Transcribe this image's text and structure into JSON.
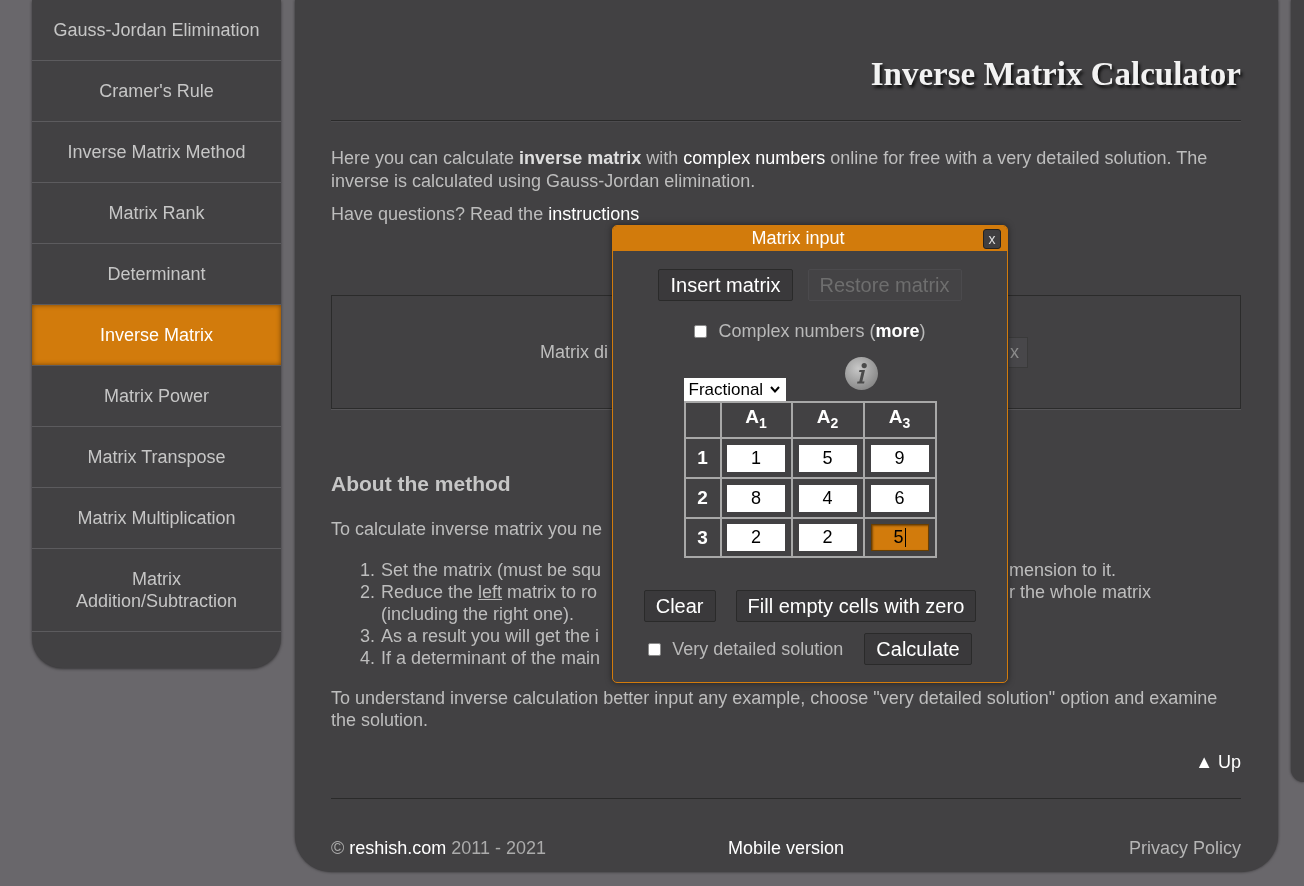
{
  "sidebar": {
    "items": [
      {
        "label": "Gauss-Jordan Elimination",
        "selected": false
      },
      {
        "label": "Cramer's Rule",
        "selected": false
      },
      {
        "label": "Inverse Matrix Method",
        "selected": false
      },
      {
        "label": "Matrix Rank",
        "selected": false
      },
      {
        "label": "Determinant",
        "selected": false
      },
      {
        "label": "Inverse Matrix",
        "selected": true
      },
      {
        "label": "Matrix Power",
        "selected": false
      },
      {
        "label": "Matrix Transpose",
        "selected": false
      },
      {
        "label": "Matrix Multiplication",
        "selected": false
      },
      {
        "label": "Matrix Addition/Subtraction",
        "selected": false
      }
    ]
  },
  "content": {
    "title": "Inverse Matrix Calculator",
    "intro": {
      "before": "Here you can calculate **inverse matrix** with ",
      "link": "complex numbers",
      "after": " online for free with a very detailed solution. The inverse is calculated using Gauss-Jordan elimination."
    },
    "help": {
      "text": "Have questions? Read the",
      "link": "instructions"
    },
    "dimension_box": {
      "label": "Matrix di",
      "button": "x"
    },
    "method": {
      "heading": "About the method",
      "lead": "To calculate inverse matrix you ne",
      "steps": [
        {
          "number": "1.",
          "lines": [
            {
              "left": [
                {
                  "text": "Set the matrix (must be squ",
                  "underlined": false
                }
              ],
              "right": "mension to it."
            }
          ]
        },
        {
          "number": "2.",
          "lines": [
            {
              "left": [
                {
                  "text": "Reduce the ",
                  "underlined": false
                },
                {
                  "text": "left",
                  "underlined": true
                },
                {
                  "text": " matrix to ro",
                  "underlined": false
                }
              ],
              "right": "r the whole matrix"
            },
            {
              "left": [
                {
                  "text": "(including the right one).",
                  "underlined": false
                }
              ]
            }
          ]
        },
        {
          "number": "3.",
          "lines": [
            {
              "left": [
                {
                  "text": "As a result you will get the i",
                  "underlined": false
                }
              ]
            }
          ]
        },
        {
          "number": "4.",
          "lines": [
            {
              "left": [
                {
                  "text": "If a determinant of the main",
                  "underlined": false
                }
              ]
            }
          ]
        }
      ],
      "closing": "To understand inverse calculation better input any example, choose \"very detailed solution\" option and examine the solution.",
      "up_link": "▲ Up"
    },
    "footer": {
      "copyright": "©",
      "site_link": "reshish.com",
      "years": "2011 - 2021",
      "mobile_link": "Mobile version",
      "privacy_link": "Privacy Policy"
    }
  },
  "dialog": {
    "title": "Matrix input",
    "close": "x",
    "top_buttons": [
      {
        "label": "Insert matrix",
        "disabled": false
      },
      {
        "label": "Restore matrix",
        "disabled": true
      }
    ],
    "complex_numbers": {
      "checked": false,
      "label_before": "Complex numbers (",
      "link": "more",
      "label_after": ")"
    },
    "format_select": {
      "value": "Fractional"
    },
    "matrix": {
      "columns": [
        "A$_{1}$",
        "A$_{2}$",
        "A$_{3}$"
      ],
      "rows": [
        {
          "label": "1",
          "cells": [
            {
              "value": "1",
              "focused": false
            },
            {
              "value": "5",
              "focused": false
            },
            {
              "value": "9",
              "focused": false
            }
          ]
        },
        {
          "label": "2",
          "cells": [
            {
              "value": "8",
              "focused": false
            },
            {
              "value": "4",
              "focused": false
            },
            {
              "value": "6",
              "focused": false
            }
          ]
        },
        {
          "label": "3",
          "cells": [
            {
              "value": "2",
              "focused": false
            },
            {
              "value": "2",
              "focused": false
            },
            {
              "value": "5",
              "focused": true
            }
          ]
        }
      ]
    },
    "bottom_buttons": [
      "Clear",
      "Fill empty cells with zero"
    ],
    "detailed_solution": {
      "checked": false,
      "label": "Very detailed solution"
    },
    "calculate_button": "Calculate"
  }
}
